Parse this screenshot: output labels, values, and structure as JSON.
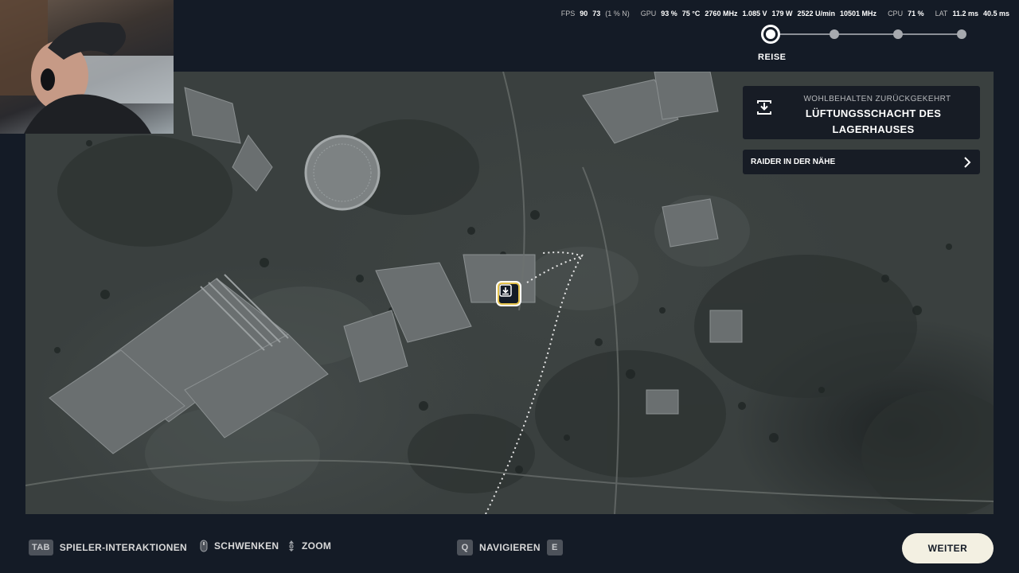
{
  "perf": {
    "fps_label": "FPS",
    "fps_value": "90",
    "fps_low": "73",
    "fps_low_unit": "(1 % N)",
    "gpu_label": "GPU",
    "gpu_load": "93 %",
    "gpu_temp": "75 °C",
    "gpu_clock": "2760 MHz",
    "gpu_volt": "1.085 V",
    "gpu_power": "179 W",
    "gpu_fan": "2522 U/min",
    "gpu_mem": "10501 MHz",
    "cpu_label": "CPU",
    "cpu_load": "71 %",
    "lat_label": "LAT",
    "lat_1": "11.2 ms",
    "lat_2": "40.5 ms"
  },
  "progress": {
    "active_label": "REISE",
    "total_steps": 4,
    "current_step": 1
  },
  "panel": {
    "subtitle": "WOHLBEHALTEN ZURÜCKGEKEHRT",
    "title_line1": "LÜFTUNGSSCHACHT DES",
    "title_line2": "LAGERHAUSES",
    "icon": "extract-hatch-icon"
  },
  "raider": {
    "label": "RAIDER IN DER NÄHE",
    "icon": "chevron-right-icon"
  },
  "hints": {
    "tab_key": "TAB",
    "tab_label": "SPIELER-INTERAKTIONEN",
    "pan_label": "SCHWENKEN",
    "zoom_label": "ZOOM",
    "q_key": "Q",
    "nav_label": "NAVIGIEREN",
    "e_key": "E"
  },
  "continue_button": "WEITER",
  "colors": {
    "background": "#141b26",
    "panel": "#141a24",
    "marker_accent": "#e3c14a",
    "button_bg": "#f3f0e2"
  }
}
